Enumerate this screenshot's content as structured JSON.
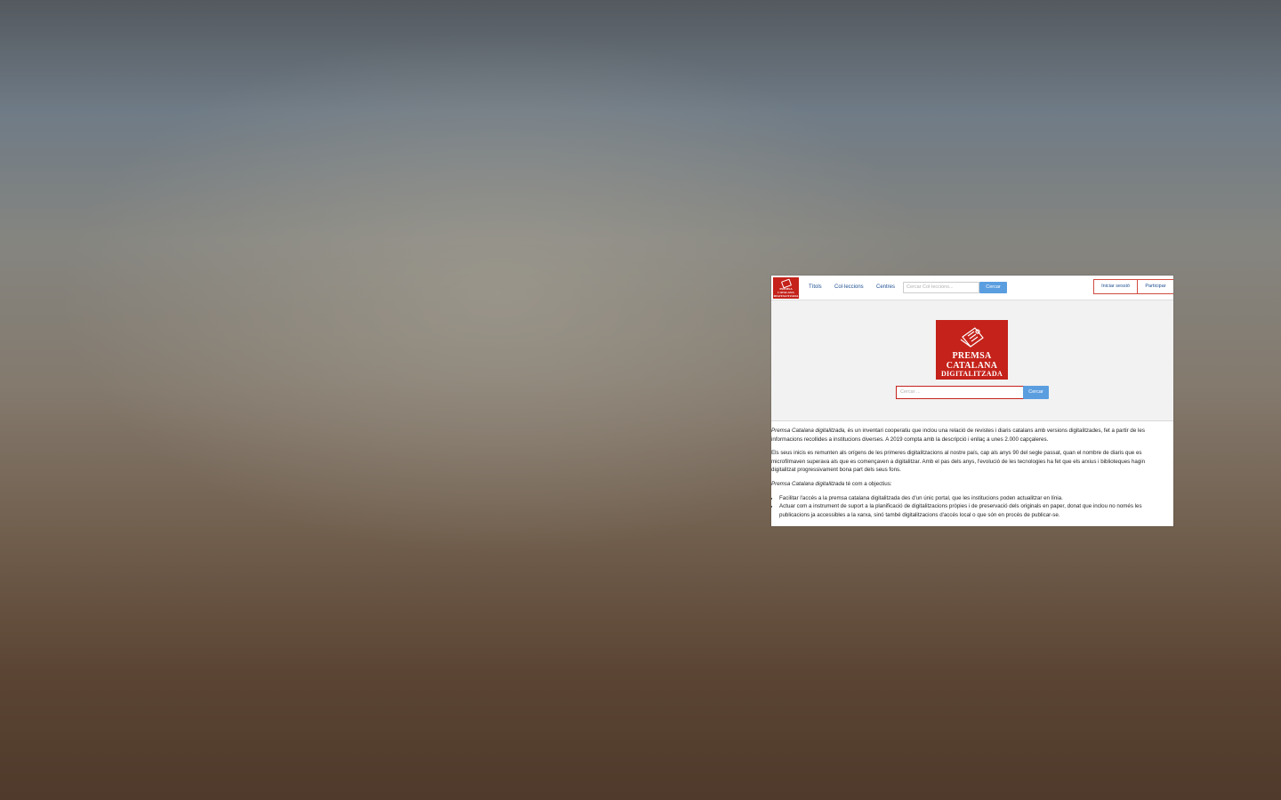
{
  "navbar": {
    "logo_lines": [
      "PREMSA",
      "CATALANA",
      "DIGITALITZADA"
    ],
    "links": [
      "Títols",
      "Col·leccions",
      "Centres"
    ],
    "search_placeholder": "Cercar Col·leccions...",
    "search_button": "Cercar",
    "login": "Iniciar sessió",
    "participate": "Participar"
  },
  "hero": {
    "logo_line1": "PREMSA",
    "logo_line2": "CATALANA",
    "logo_line3": "DIGITALITZADA",
    "search_placeholder": "Cercar ...",
    "search_button": "Cercar"
  },
  "content": {
    "intro_em": "Premsa Catalana digitalitzada,",
    "intro_rest": " és un inventari cooperatiu que inclou una relació de revistes i diaris catalans amb versions digitalitzades, fet a partir de les informacions recollides a institucions diverses. A 2019 compta amb la descripció i enllaç a unes 2.000 capçaleres.",
    "paragraph2": "Els seus inicis es remunten als orígens de les primeres digitalitzacions al nostre país, cap als anys 90 del segle passat, quan el nombre de diaris que es microfilmaven superava als que es començaven a digitalitzar. Amb el pas dels anys, l'evolució de les tecnologies ha fet que els arxius i biblioteques hagin digitalitzat progressivament bona part dels seus fons.",
    "objectives_em": "Premsa Catalana digitalitzada",
    "objectives_rest": " té com a objectius:",
    "objectives": [
      "Facilitar l'accés a la premsa catalana digitalitzada des d'un únic portal, que les institucions poden actualitzar en línia.",
      "Actuar com a instrument de suport a la planificació de digitalitzacions pròpies i de preservació dels originals en paper, donat que inclou no només les publicacions ja accessibles a la xarxa, sinó també digitalitzacions d'accés local o que són en procés de publicar-se."
    ]
  },
  "colors": {
    "brand_red": "#c4221a",
    "button_blue": "#5b9ee0",
    "link_blue": "#1d4f91"
  }
}
